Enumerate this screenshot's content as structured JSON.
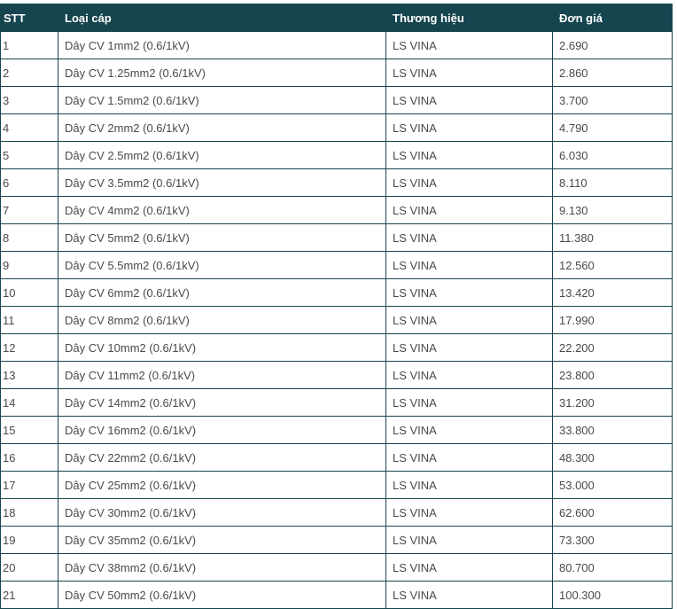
{
  "table": {
    "headers": [
      "STT",
      "Loại cáp",
      "Thương hiệu",
      "Đơn giá"
    ],
    "rows": [
      [
        "1",
        "Dây CV 1mm2 (0.6/1kV)",
        "LS VINA",
        "2.690"
      ],
      [
        "2",
        "Dây CV 1.25mm2 (0.6/1kV)",
        "LS VINA",
        "2.860"
      ],
      [
        "3",
        "Dây CV 1.5mm2 (0.6/1kV)",
        "LS VINA",
        "3.700"
      ],
      [
        "4",
        "Dây CV 2mm2 (0.6/1kV)",
        "LS VINA",
        "4.790"
      ],
      [
        "5",
        "Dây CV 2.5mm2 (0.6/1kV)",
        "LS VINA",
        "6.030"
      ],
      [
        "6",
        "Dây CV 3.5mm2 (0.6/1kV)",
        "LS VINA",
        "8.110"
      ],
      [
        "7",
        "Dây CV 4mm2 (0.6/1kV)",
        "LS VINA",
        "9.130"
      ],
      [
        "8",
        "Dây CV 5mm2 (0.6/1kV)",
        "LS VINA",
        "11.380"
      ],
      [
        "9",
        "Dây CV 5.5mm2 (0.6/1kV)",
        "LS VINA",
        "12.560"
      ],
      [
        "10",
        "Dây CV 6mm2 (0.6/1kV)",
        "LS VINA",
        "13.420"
      ],
      [
        "11",
        "Dây CV 8mm2 (0.6/1kV)",
        "LS VINA",
        "17.990"
      ],
      [
        "12",
        "Dây CV 10mm2 (0.6/1kV)",
        "LS VINA",
        "22.200"
      ],
      [
        "13",
        "Dây CV 11mm2 (0.6/1kV)",
        "LS VINA",
        "23.800"
      ],
      [
        "14",
        "Dây CV 14mm2 (0.6/1kV)",
        "LS VINA",
        "31.200"
      ],
      [
        "15",
        "Dây CV 16mm2 (0.6/1kV)",
        "LS VINA",
        "33.800"
      ],
      [
        "16",
        "Dây CV 22mm2 (0.6/1kV)",
        "LS VINA",
        "48.300"
      ],
      [
        "17",
        "Dây CV 25mm2 (0.6/1kV)",
        "LS VINA",
        "53.000"
      ],
      [
        "18",
        "Dây CV 30mm2 (0.6/1kV)",
        "LS VINA",
        "62.600"
      ],
      [
        "19",
        "Dây CV 35mm2 (0.6/1kV)",
        "LS VINA",
        "73.300"
      ],
      [
        "20",
        "Dây CV 38mm2 (0.6/1kV)",
        "LS VINA",
        "80.700"
      ],
      [
        "21",
        "Dây CV 50mm2 (0.6/1kV)",
        "LS VINA",
        "100.300"
      ]
    ]
  },
  "colors": {
    "header_bg": "#16454f",
    "header_text": "#ffffff",
    "border": "#16454f",
    "cell_text": "#4a4a4a"
  }
}
